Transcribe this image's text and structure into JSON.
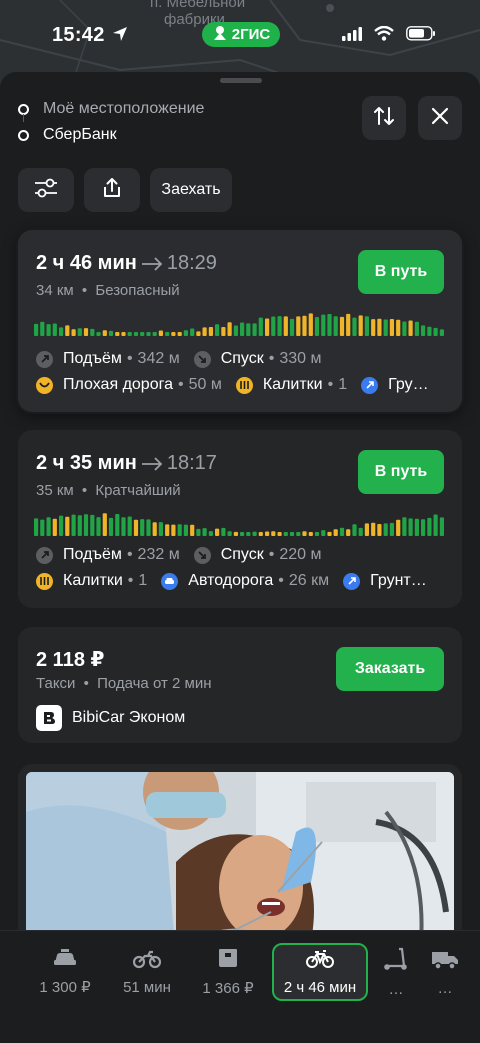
{
  "map": {
    "labels": [
      "п. Мебельной",
      "фабрики"
    ]
  },
  "status_bar": {
    "time": "15:42",
    "brand": "2ГИС"
  },
  "route_points": {
    "from": "Моё местоположение",
    "to": "СберБанк"
  },
  "toolbar": {
    "drive_in_label": "Заехать"
  },
  "routes": [
    {
      "duration": "2 ч 46 мин",
      "arrival": "18:29",
      "distance": "34 км",
      "kind": "Безопасный",
      "go_label": "В путь",
      "climb_label": "Подъём",
      "climb_value": "342 м",
      "descent_label": "Спуск",
      "descent_value": "330 м",
      "tag1_label": "Плохая дорога",
      "tag1_value": "50 м",
      "tag2_label": "Калитки",
      "tag2_value": "1",
      "tag3_label": "Гру…"
    },
    {
      "duration": "2 ч 35 мин",
      "arrival": "18:17",
      "distance": "35 км",
      "kind": "Кратчайший",
      "go_label": "В путь",
      "climb_label": "Подъём",
      "climb_value": "232 м",
      "descent_label": "Спуск",
      "descent_value": "220 м",
      "tag1_label": "Калитки",
      "tag1_value": "1",
      "tag2_label": "Автодорога",
      "tag2_value": "26 км",
      "tag3_label": "Грунт…"
    }
  ],
  "taxi": {
    "price": "2 118 ₽",
    "type": "Такси",
    "pickup": "Подача от 2 мин",
    "provider": "BibiCar Эконом",
    "order_label": "Заказать"
  },
  "transport_modes": [
    {
      "icon": "taxi-icon",
      "label": "1 300 ₽"
    },
    {
      "icon": "motorcycle-icon",
      "label": "51 мин"
    },
    {
      "icon": "delivery-box-icon",
      "label": "1 366 ₽"
    },
    {
      "icon": "bicycle-icon",
      "label": "2 ч 46 мин",
      "active": true
    },
    {
      "icon": "scooter-icon",
      "label": "…"
    },
    {
      "icon": "truck-icon",
      "label": "…"
    }
  ],
  "colors": {
    "accent_green": "#22b14c",
    "origin_dot": "#29b44d",
    "destination_dot": "#2e7bf0",
    "elevation_flat": "#21a446",
    "elevation_steep": "#f0b429",
    "warning_badge": "#f0b429",
    "info_badge": "#3b7bf0"
  }
}
